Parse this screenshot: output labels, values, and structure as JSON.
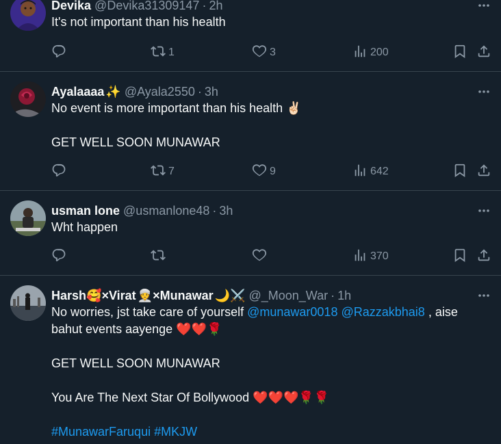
{
  "tweets": [
    {
      "name": "Devika",
      "name_emoji": "",
      "handle": "@Devika31309147",
      "time": "2h",
      "body": [
        "It's not important than his health"
      ],
      "replies": "",
      "retweets": "1",
      "likes": "3",
      "views": "200"
    },
    {
      "name": "Ayalaaaa",
      "name_emoji": "✨",
      "handle": "@Ayala2550",
      "time": "3h",
      "body": [
        "No event is more important than his health ✌🏻",
        "",
        "GET WELL SOON MUNAWAR"
      ],
      "replies": "",
      "retweets": "7",
      "likes": "9",
      "views": "642"
    },
    {
      "name": "usman lone",
      "name_emoji": "",
      "handle": "@usmanlone48",
      "time": "3h",
      "body": [
        "Wht happen"
      ],
      "replies": "",
      "retweets": "",
      "likes": "",
      "views": "370"
    },
    {
      "name_parts": [
        "Harsh",
        "🥰",
        "×Virat",
        "👳",
        "×Munawar",
        "🌙⚔️"
      ],
      "handle": "@_Moon_War",
      "time": "1h",
      "body_line1_text": "No worries, jst take care of yourself ",
      "mention1": "@munawar0018",
      "mention2": "@Razzakbhai8",
      "body_line1_rest": " , aise",
      "body_line2": "bahut events aayenge ❤️❤️🌹",
      "body_line4": "GET WELL SOON MUNAWAR",
      "body_line6": "You Are The Next Star Of Bollywood ❤️❤️❤️🌹🌹",
      "hashtags": "#MunawarFaruqui #MKJW"
    }
  ],
  "separator": "·",
  "colors": {
    "background": "#15202b",
    "border": "#38444d",
    "text": "#f7f9f9",
    "secondary": "#8b98a5",
    "link": "#1d9bf0"
  },
  "icons": [
    "more-icon",
    "reply-icon",
    "retweet-icon",
    "like-icon",
    "views-icon",
    "bookmark-icon",
    "share-icon"
  ]
}
